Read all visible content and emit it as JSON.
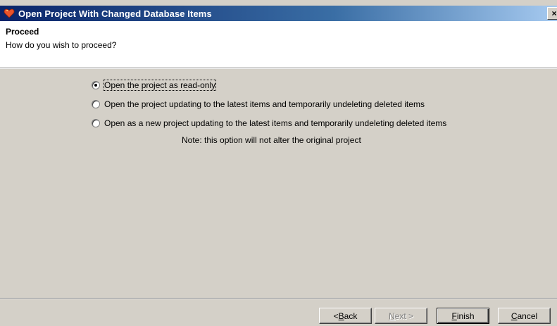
{
  "window": {
    "title": "Open Project With Changed Database Items",
    "close_glyph": "×",
    "icon": "app-heart-icon"
  },
  "header": {
    "title": "Proceed",
    "subtitle": "How do you wish to proceed?"
  },
  "options": [
    {
      "label": "Open the project as read-only",
      "checked": true
    },
    {
      "label": "Open the project updating to the latest items and temporarily undeleting deleted items",
      "checked": false
    },
    {
      "label": "Open as a new project updating to the latest items and temporarily undeleting deleted items",
      "checked": false
    }
  ],
  "note": "Note: this option will not alter the original project",
  "buttons": {
    "back": {
      "prefix": "< ",
      "mnemonic": "B",
      "rest": "ack"
    },
    "next": {
      "prefix": "",
      "mnemonic": "N",
      "rest": "ext >",
      "enabled": false
    },
    "finish": {
      "prefix": "",
      "mnemonic": "F",
      "rest": "inish"
    },
    "cancel": {
      "prefix": "",
      "mnemonic": "C",
      "rest": "ancel"
    }
  },
  "colors": {
    "titlebar_start": "#0a246a",
    "titlebar_end": "#a6caf0",
    "face": "#d4d0c8"
  }
}
